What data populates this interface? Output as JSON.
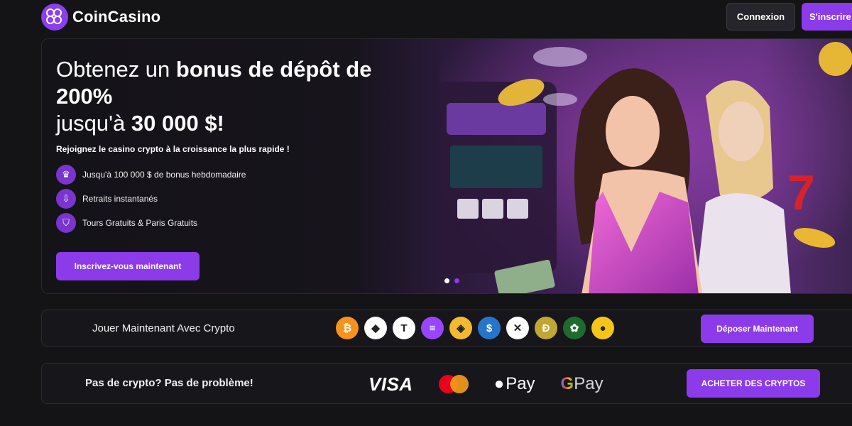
{
  "header": {
    "logo_text": "CoinCasino",
    "login_label": "Connexion",
    "signup_label": "S'inscrire"
  },
  "hero": {
    "title_part1": "Obtenez un ",
    "title_bold1": "bonus de dépôt de 200%",
    "title_part2": "jusqu'à ",
    "title_bold2": "30 000 $!",
    "subtitle": "Rejoignez le casino crypto à la croissance la plus rapide !",
    "features": [
      {
        "icon": "crown-icon",
        "label": "Jusqu'à 100 000 $ de bonus hebdomadaire"
      },
      {
        "icon": "withdraw-icon",
        "label": "Retraits instantanés"
      },
      {
        "icon": "shield-icon",
        "label": "Tours Gratuits & Paris Gratuits"
      }
    ],
    "cta_label": "Inscrivez-vous maintenant",
    "slides_total": 2,
    "slide_active": 2
  },
  "crypto_bar": {
    "label": "Jouer Maintenant Avec Crypto",
    "coins": [
      {
        "name": "bitcoin-icon",
        "symbol": "₿",
        "color": "#f7931a"
      },
      {
        "name": "ethereum-icon",
        "symbol": "◆",
        "color": "#ffffff"
      },
      {
        "name": "tether-icon",
        "symbol": "T",
        "color": "#ffffff"
      },
      {
        "name": "solana-icon",
        "symbol": "≡",
        "color": "#9945ff"
      },
      {
        "name": "bnb-icon",
        "symbol": "◈",
        "color": "#f3ba2f"
      },
      {
        "name": "usdc-icon",
        "symbol": "$",
        "color": "#2775ca"
      },
      {
        "name": "xrp-icon",
        "symbol": "✕",
        "color": "#ffffff"
      },
      {
        "name": "dogecoin-icon",
        "symbol": "Ð",
        "color": "#c2a633"
      },
      {
        "name": "token-icon",
        "symbol": "✿",
        "color": "#1f6b2e"
      },
      {
        "name": "shiba-icon",
        "symbol": "●",
        "color": "#f5c518"
      }
    ],
    "deposit_label": "Déposer Maintenant"
  },
  "payment_bar": {
    "label": "Pas de crypto? Pas de problème!",
    "visa": "VISA",
    "applepay": "Pay",
    "gpay_g": "G",
    "gpay": "Pay",
    "buy_label": "ACHETER DES CRYPTOS"
  },
  "colors": {
    "accent": "#8c3bea",
    "background": "#141316"
  }
}
